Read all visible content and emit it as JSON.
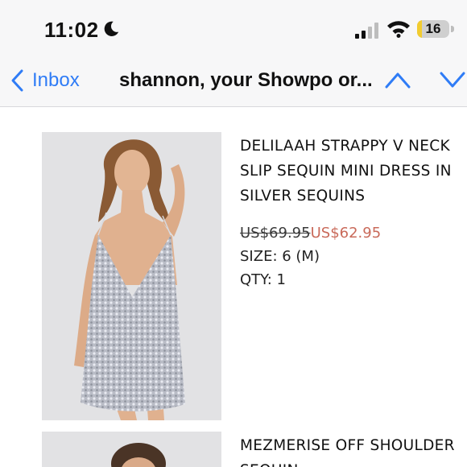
{
  "status_bar": {
    "time": "11:02",
    "battery_level": "16",
    "battery_fill_fraction": 0.16,
    "icons": [
      "moon-icon",
      "signal-icon",
      "wifi-icon",
      "battery-icon"
    ]
  },
  "nav": {
    "back_label": "Inbox",
    "subject": "shannon, your Showpo or...",
    "accent_color": "#2f7cf6"
  },
  "products": [
    {
      "title": "DELILAAH STRAPPY V NECK SLIP SEQUIN MINI DRESS IN SILVER SEQUINS",
      "price_old": "US$69.95",
      "price_new": "US$62.95",
      "size": "SIZE: 6 (M)",
      "qty": "QTY: 1"
    },
    {
      "title": "MEZMERISE OFF SHOULDER SEQUIN"
    }
  ],
  "colors": {
    "sale_price": "#c96a5a",
    "bar_background": "#f7f7f8"
  }
}
